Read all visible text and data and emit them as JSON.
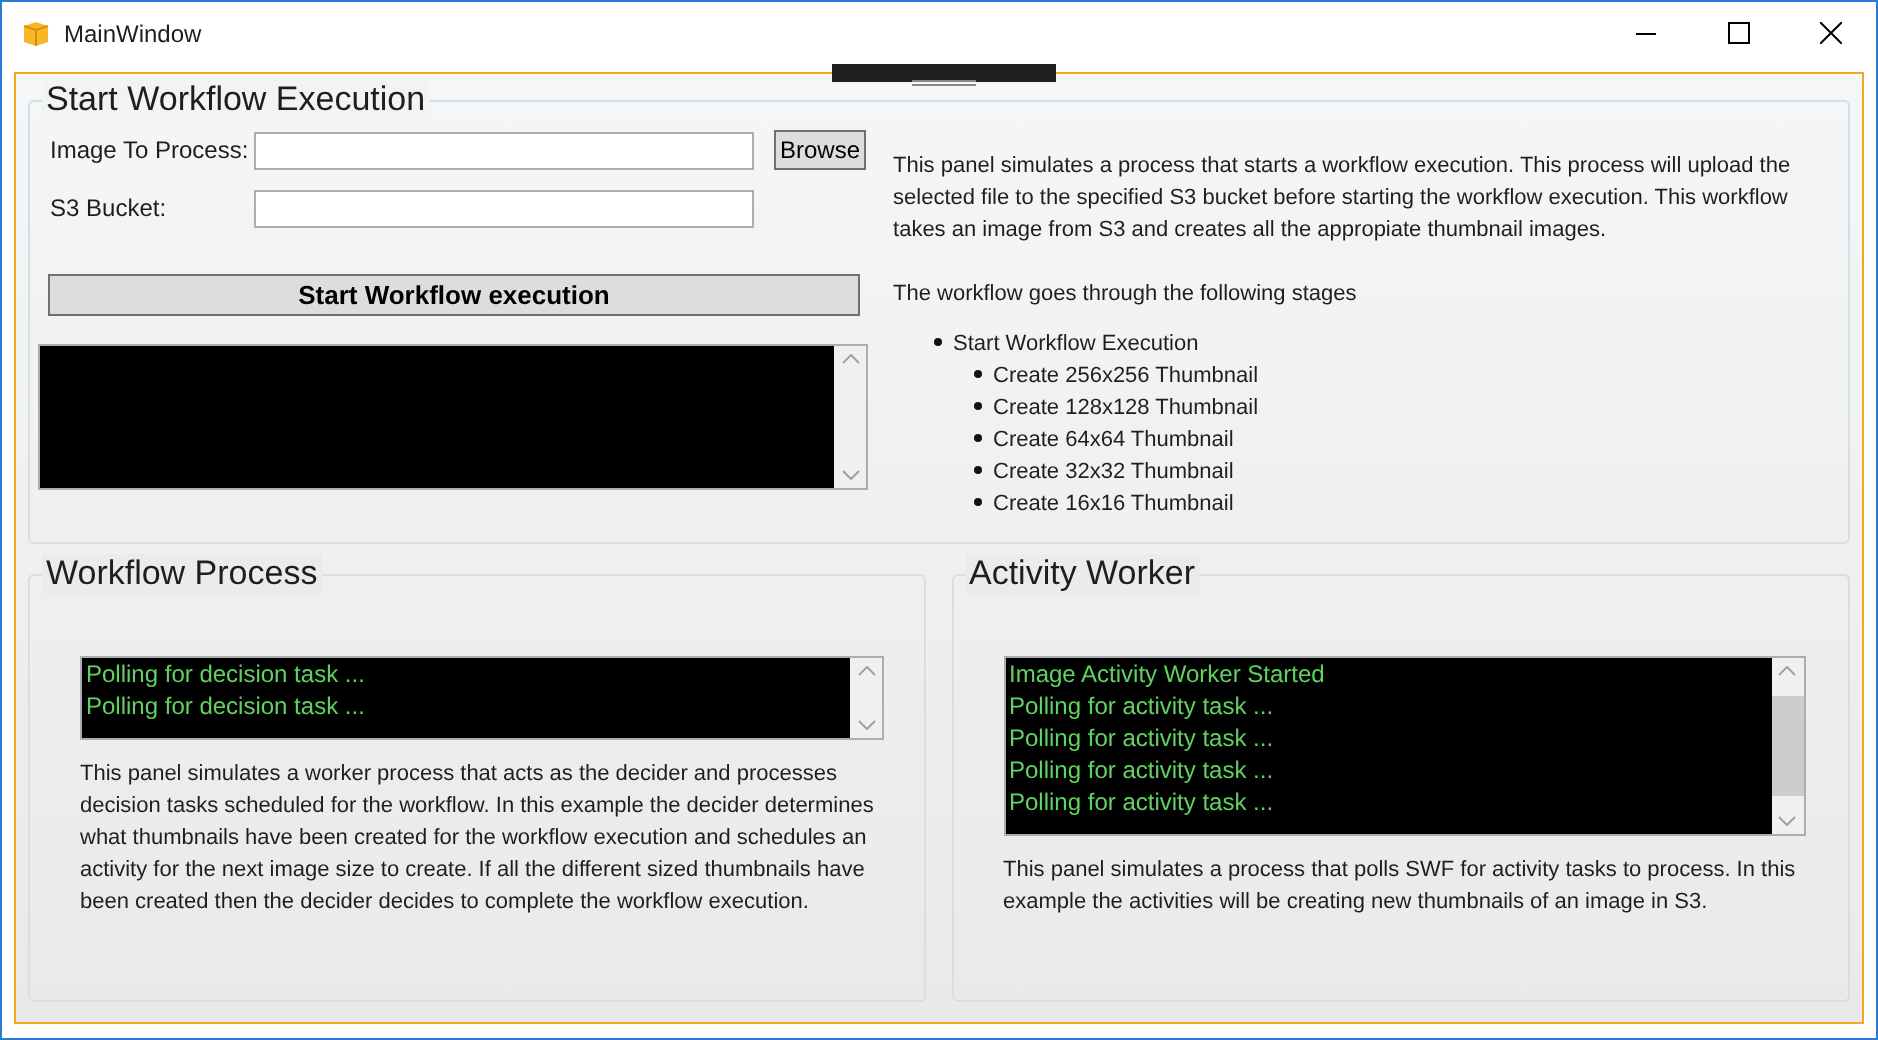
{
  "window": {
    "title": "MainWindow"
  },
  "start_panel": {
    "title": "Start Workflow Execution",
    "fields": [
      {
        "label": "Image To Process:",
        "kind": "file"
      },
      {
        "label": "S3 Bucket:",
        "kind": "text"
      }
    ],
    "browse_button": "Browse",
    "start_button": "Start Workflow execution",
    "description": "This panel simulates a process that starts a workflow execution. This process will upload the selected file to the specified S3 bucket before starting the workflow execution. This workflow takes an image from S3 and creates all the appropiate thumbnail images.",
    "stages_intro": "The workflow goes through the following stages",
    "stages": [
      {
        "label": "Start Workflow Execution",
        "children": [
          {
            "label": "Create 256x256 Thumbnail"
          },
          {
            "label": "Create 128x128 Thumbnail"
          },
          {
            "label": "Create 64x64 Thumbnail"
          },
          {
            "label": "Create 32x32 Thumbnail"
          },
          {
            "label": "Create 16x16 Thumbnail"
          }
        ]
      }
    ]
  },
  "workflow_process": {
    "title": "Workflow Process",
    "log_lines": [
      "Polling for decision task ...",
      "Polling for decision task ..."
    ],
    "description": "This panel simulates a worker process that acts as the decider and processes decision tasks scheduled for the workflow. In this example the decider determines what thumbnails have been created for the workflow execution and schedules an activity for the next image size to create. If all the different sized thumbnails have been created then the decider decides to complete the workflow execution."
  },
  "activity_worker": {
    "title": "Activity Worker",
    "log_lines": [
      "Image Activity Worker Started",
      "Polling for activity task ...",
      "Polling for activity task ...",
      "Polling for activity task ...",
      "Polling for activity task ..."
    ],
    "description": "This panel simulates a process that polls SWF for activity tasks to process. In this example the activities will be creating new thumbnails of an image in S3."
  }
}
